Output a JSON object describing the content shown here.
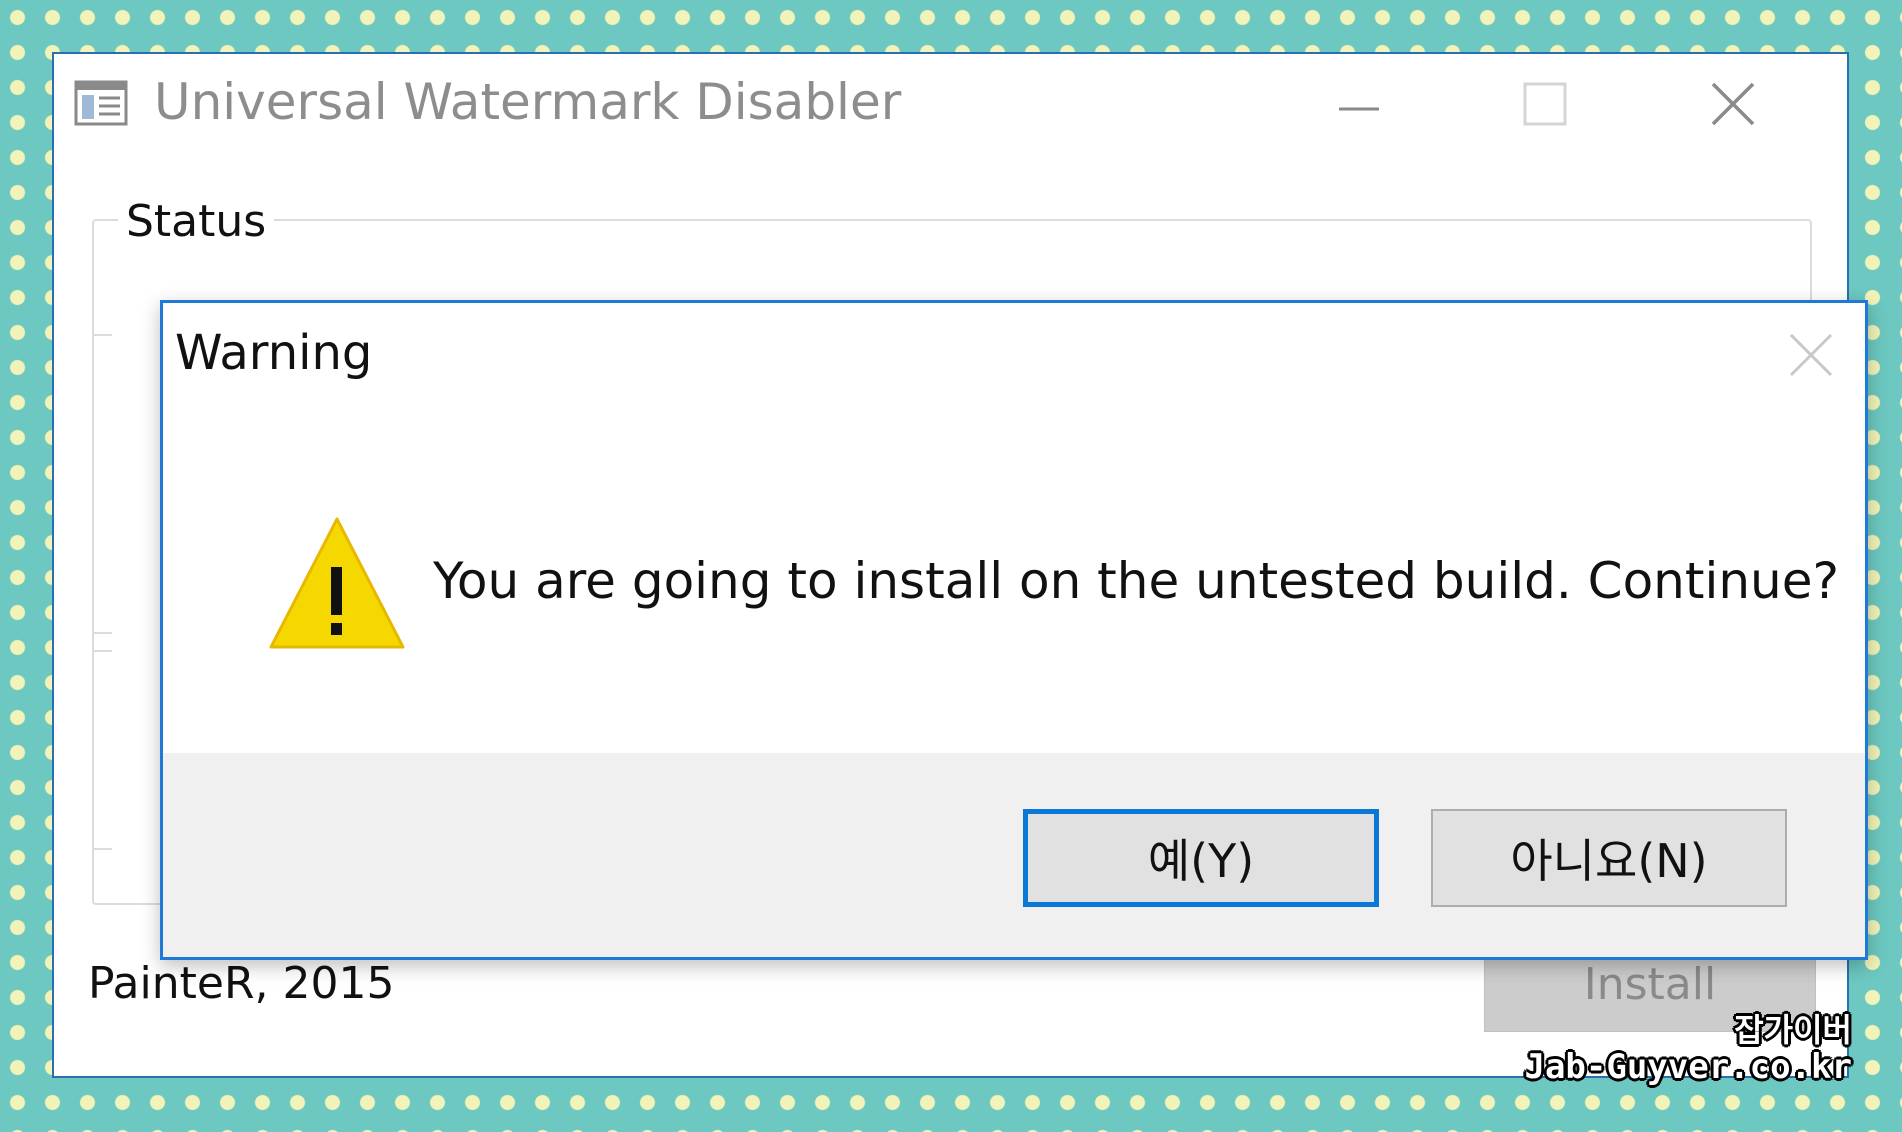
{
  "window": {
    "title": "Universal Watermark Disabler",
    "icon": "app-window-icon",
    "controls": [
      "minimize-icon",
      "maximize-icon",
      "close-icon"
    ]
  },
  "status_group": {
    "label": "Status"
  },
  "footer": {
    "credit": "PainteR, 2015",
    "install_label": "Install"
  },
  "dialog": {
    "title": "Warning",
    "icon": "warning-icon",
    "message": "You are going to install on the untested build. Continue?",
    "yes_label": "예(Y)",
    "no_label": "아니요(N)"
  },
  "watermark": {
    "korean": "잡가이버",
    "domain": "Jab-Guyver.co.kr"
  },
  "colors": {
    "background": "#6cc8c0",
    "dots": "#f2f3b8",
    "accent": "#1f7ad6",
    "warning_yellow": "#f5d800"
  }
}
